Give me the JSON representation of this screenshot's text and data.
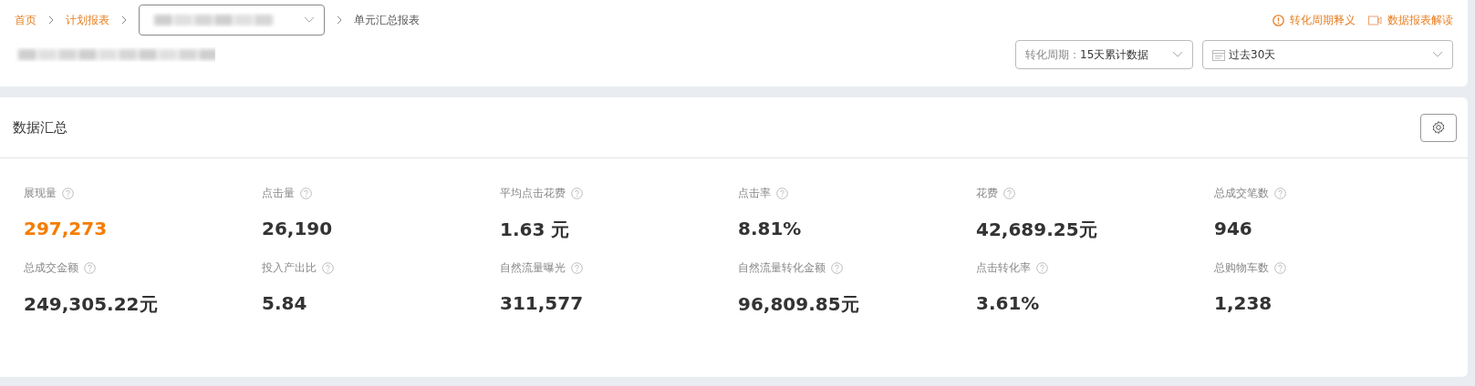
{
  "breadcrumb": [
    {
      "label": "首页",
      "kind": "link"
    },
    {
      "label": "计划报表",
      "kind": "link"
    },
    {
      "kind": "select"
    },
    {
      "label": "单元汇总报表",
      "kind": "current"
    }
  ],
  "header_links": [
    {
      "label": "转化周期释义",
      "kind": "info"
    },
    {
      "label": "数据报表解读",
      "kind": "video"
    }
  ],
  "filters": [
    {
      "label": "转化周期：",
      "value": "15天累计数据",
      "kind": "plain"
    },
    {
      "value": "过去30天",
      "kind": "date"
    }
  ],
  "summary": {
    "title": "数据汇总",
    "metrics": [
      {
        "label": "展现量",
        "value": "297,273",
        "highlighted": true
      },
      {
        "label": "点击量",
        "value": "26,190",
        "highlighted": false
      },
      {
        "label": "平均点击花费",
        "value": "1.63 元",
        "highlighted": false
      },
      {
        "label": "点击率",
        "value": "8.81%",
        "highlighted": false
      },
      {
        "label": "花费",
        "value": "42,689.25元",
        "highlighted": false
      },
      {
        "label": "总成交笔数",
        "value": "946",
        "highlighted": false
      },
      {
        "label": "总成交金额",
        "value": "249,305.22元",
        "highlighted": false
      },
      {
        "label": "投入产出比",
        "value": "5.84",
        "highlighted": false
      },
      {
        "label": "自然流量曝光",
        "value": "311,577",
        "highlighted": false
      },
      {
        "label": "自然流量转化金额",
        "value": "96,809.85元",
        "highlighted": false
      },
      {
        "label": "点击转化率",
        "value": "3.61%",
        "highlighted": false
      },
      {
        "label": "总购物车数",
        "value": "1,238",
        "highlighted": false
      }
    ]
  }
}
